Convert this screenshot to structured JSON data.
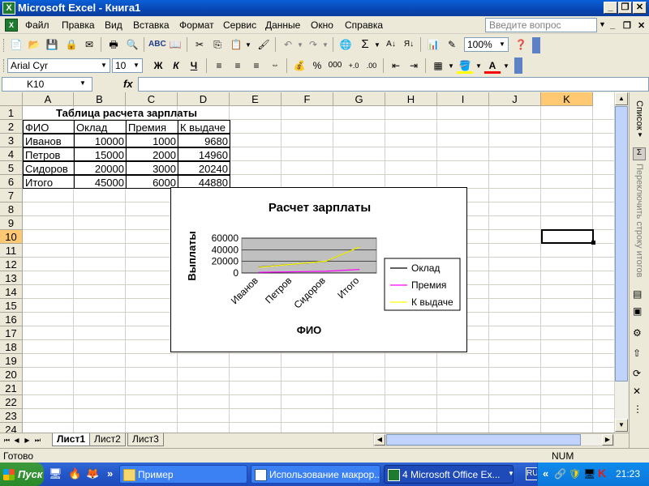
{
  "app": {
    "title": "Microsoft Excel - Книга1"
  },
  "menu": [
    "Файл",
    "Правка",
    "Вид",
    "Вставка",
    "Формат",
    "Сервис",
    "Данные",
    "Окно",
    "Справка"
  ],
  "ask_placeholder": "Введите вопрос",
  "toolbar": {
    "zoom": "100%",
    "font_name": "Arial Cyr",
    "font_size": "10",
    "bold": "Ж",
    "italic": "К",
    "underline": "Ч",
    "percent": "%",
    "thousands": "000",
    "sum": "Σ"
  },
  "formula": {
    "namebox": "K10",
    "fx": "fx",
    "value": ""
  },
  "grid": {
    "columns": [
      "A",
      "B",
      "C",
      "D",
      "E",
      "F",
      "G",
      "H",
      "I",
      "J",
      "K"
    ],
    "rows": [
      "1",
      "2",
      "3",
      "4",
      "5",
      "6",
      "7",
      "8",
      "9",
      "10",
      "11",
      "12",
      "13",
      "14",
      "15",
      "16",
      "17",
      "18",
      "19",
      "20",
      "21",
      "22",
      "23",
      "24"
    ],
    "title": "Таблица расчета зарплаты",
    "headers": [
      "ФИО",
      "Оклад",
      "Премия",
      "К выдаче"
    ],
    "data": [
      [
        "Иванов",
        "10000",
        "1000",
        "9680"
      ],
      [
        "Петров",
        "15000",
        "2000",
        "14960"
      ],
      [
        "Сидоров",
        "20000",
        "3000",
        "20240"
      ],
      [
        "Итого",
        "45000",
        "6000",
        "44880"
      ]
    ]
  },
  "chart_data": {
    "type": "line",
    "title": "Расчет зарплаты",
    "xlabel": "ФИО",
    "ylabel": "Выплаты",
    "categories": [
      "Иванов",
      "Петров",
      "Сидоров",
      "Итого"
    ],
    "ylim": [
      0,
      60000
    ],
    "yticks": [
      "60000",
      "40000",
      "20000",
      "0"
    ],
    "legend_position": "right",
    "series": [
      {
        "name": "Оклад",
        "values": [
          10000,
          15000,
          20000,
          45000
        ],
        "color": "#000000"
      },
      {
        "name": "Премия",
        "values": [
          1000,
          2000,
          3000,
          6000
        ],
        "color": "#ff00ff"
      },
      {
        "name": "К выдаче",
        "values": [
          9680,
          14960,
          20240,
          44880
        ],
        "color": "#ffff00"
      }
    ],
    "plot_background": "#c0c0c0"
  },
  "sheets": [
    "Лист1",
    "Лист2",
    "Лист3"
  ],
  "status": {
    "left": "Готово",
    "num": "NUM"
  },
  "taskpane": {
    "list_label": "Список",
    "toggle_totals": "Переключить строку итогов"
  },
  "taskbar": {
    "start": "Пуск",
    "folder": "Пример",
    "word_task": "Использование макрор...",
    "excel_task": "4 Microsoft Office Ex...",
    "lang": "RU",
    "time": "21:23"
  }
}
